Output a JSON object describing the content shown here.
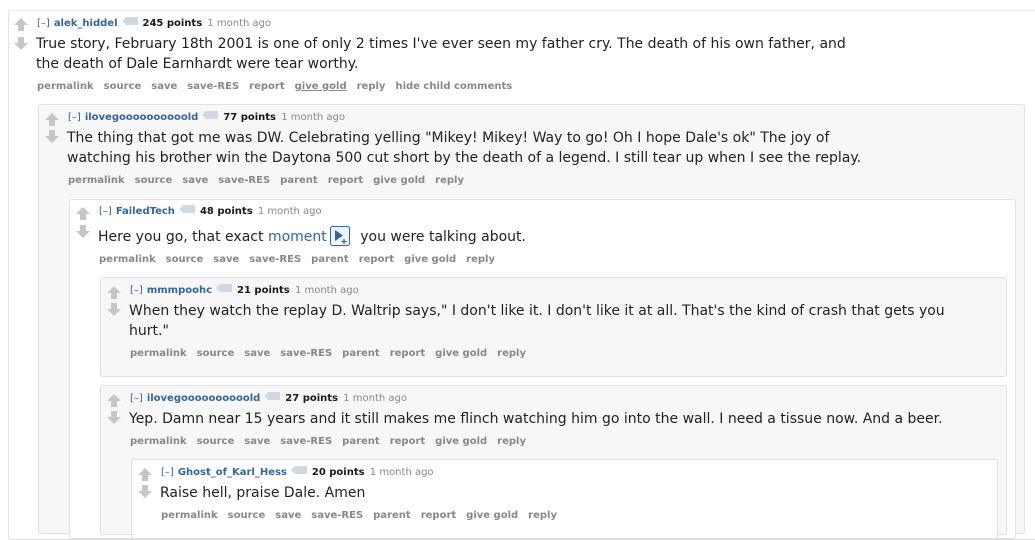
{
  "comments": [
    {
      "expand": "[–]",
      "author": "alek_hiddel",
      "score": "245 points",
      "time": "1 month ago",
      "text_lines": [
        "True story, February 18th 2001 is one of only 2 times I've ever seen my father cry. The death of his own father, and",
        "the death of Dale Earnhardt were tear worthy."
      ],
      "buttons": [
        "permalink",
        "source",
        "save",
        "save-RES",
        "report",
        "give gold",
        "reply",
        "hide child comments"
      ]
    },
    {
      "expand": "[–]",
      "author": "ilovegoooooooooold",
      "score": "77 points",
      "time": "1 month ago",
      "text_lines": [
        "The thing that got me was DW. Celebrating yelling \"Mikey! Mikey! Way to go! Oh I hope Dale's ok\" The joy of",
        "watching his brother win the Daytona 500 cut short by the death of a legend. I still tear up when I see the replay."
      ],
      "buttons": [
        "permalink",
        "source",
        "save",
        "save-RES",
        "parent",
        "report",
        "give gold",
        "reply"
      ]
    },
    {
      "expand": "[–]",
      "author": "FailedTech",
      "score": "48 points",
      "time": "1 month ago",
      "text_before": "Here you go, that exact ",
      "link_text": "moment",
      "text_after": " you were talking about.",
      "buttons": [
        "permalink",
        "source",
        "save",
        "save-RES",
        "parent",
        "report",
        "give gold",
        "reply"
      ]
    },
    {
      "expand": "[–]",
      "author": "mmmpoohc",
      "score": "21 points",
      "time": "1 month ago",
      "text_lines": [
        "When they watch the replay D. Waltrip says,\" I don't like it. I don't like it at all. That's the kind of crash that gets you",
        "hurt.\""
      ],
      "buttons": [
        "permalink",
        "source",
        "save",
        "save-RES",
        "parent",
        "report",
        "give gold",
        "reply"
      ]
    },
    {
      "expand": "[–]",
      "author": "ilovegoooooooooold",
      "score": "27 points",
      "time": "1 month ago",
      "text_lines": [
        "Yep. Damn near 15 years and it still makes me flinch watching him go into the wall. I need a tissue now. And a beer."
      ],
      "buttons": [
        "permalink",
        "source",
        "save",
        "save-RES",
        "parent",
        "report",
        "give gold",
        "reply"
      ]
    },
    {
      "expand": "[–]",
      "author": "Ghost_of_Karl_Hess",
      "score": "20 points",
      "time": "1 month ago",
      "text_lines": [
        "Raise hell, praise Dale. Amen"
      ],
      "buttons": [
        "permalink",
        "source",
        "save",
        "save-RES",
        "parent",
        "report",
        "give gold",
        "reply"
      ]
    }
  ],
  "icons": {
    "upvote": "upvote-arrow-icon",
    "downvote": "downvote-arrow-icon",
    "res_tag": "res-tag-icon",
    "media_expand": "media-expand-icon"
  },
  "colors": {
    "link": "#336699",
    "meta": "#888888",
    "arrow": "#c6c6c6",
    "nested_bg": "#f7f7f8"
  }
}
